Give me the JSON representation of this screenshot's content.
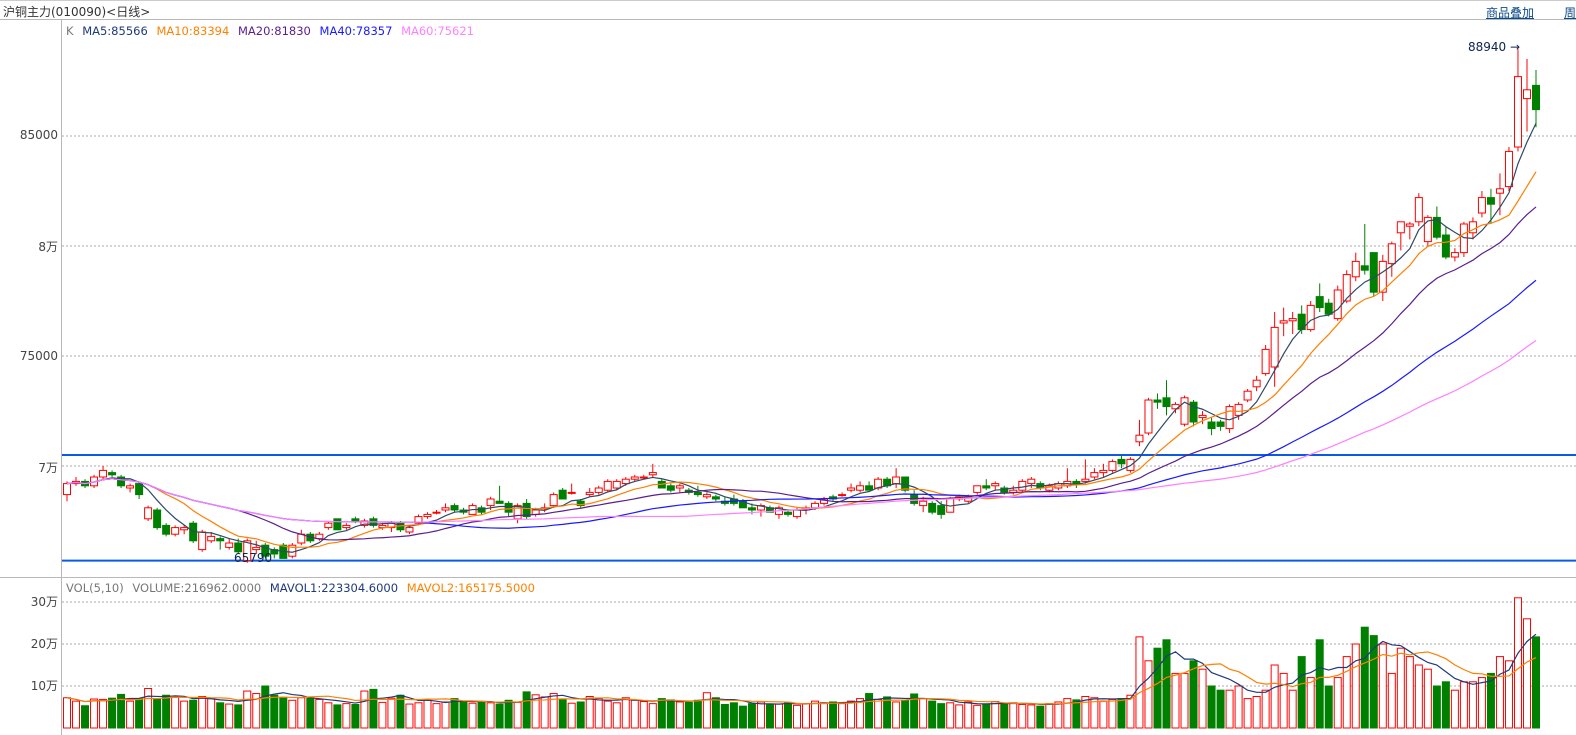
{
  "header": {
    "title": "沪铜主力(010090)<日线>",
    "overlay_link": "商品叠加",
    "period_link": "周"
  },
  "price_legend": {
    "k": "K",
    "ma5": "MA5:85566",
    "ma10": "MA10:83394",
    "ma20": "MA20:81830",
    "ma40": "MA40:78357",
    "ma60": "MA60:75621"
  },
  "volume_legend": {
    "vol": "VOL(5,10)",
    "volume": "VOLUME:216962.0000",
    "mavol1": "MAVOL1:223304.6000",
    "mavol2": "MAVOL2:165175.5000"
  },
  "colors": {
    "up": "#ff0000",
    "down": "#008000",
    "ma5": "#2f4a66",
    "ma10": "#ff8000",
    "ma20": "#5a1e8c",
    "ma40": "#1a1aff",
    "ma60": "#ff80ff",
    "support": "#0a5ae6"
  },
  "chart_data": {
    "type": "candlestick",
    "title": "沪铜主力(010090)<日线>",
    "y_ticks": [
      {
        "value": 85000,
        "label": "85000"
      },
      {
        "value": 80000,
        "label": "8万"
      },
      {
        "value": 75000,
        "label": "75000"
      },
      {
        "value": 70000,
        "label": "7万"
      }
    ],
    "vol_ticks": [
      {
        "value": 300000,
        "label": "30万"
      },
      {
        "value": 200000,
        "label": "20万"
      },
      {
        "value": 100000,
        "label": "10万"
      }
    ],
    "high_label": "88940",
    "low_label": "65790",
    "horizontal_lines": [
      70500,
      65700
    ],
    "ma_periods": [
      5,
      10,
      20,
      40,
      60
    ],
    "mavol_periods": [
      5,
      10
    ],
    "ohlc": [
      [
        68700,
        69300,
        68400,
        69200
      ],
      [
        69200,
        69500,
        69100,
        69300
      ],
      [
        69300,
        69400,
        69000,
        69100
      ],
      [
        69100,
        69600,
        69000,
        69500
      ],
      [
        69500,
        70000,
        69400,
        69800
      ],
      [
        69700,
        69800,
        69500,
        69600
      ],
      [
        69500,
        69600,
        69000,
        69100
      ],
      [
        69000,
        69200,
        68800,
        69100
      ],
      [
        69200,
        69300,
        68500,
        68700
      ],
      [
        67600,
        68200,
        67500,
        68100
      ],
      [
        68000,
        68100,
        67100,
        67200
      ],
      [
        67300,
        67400,
        66800,
        66900
      ],
      [
        66900,
        67300,
        66800,
        67200
      ],
      [
        67100,
        67300,
        66900,
        67200
      ],
      [
        67400,
        67500,
        66500,
        66600
      ],
      [
        66200,
        67100,
        66100,
        67000
      ],
      [
        66600,
        67000,
        66500,
        66800
      ],
      [
        66700,
        66800,
        66200,
        66600
      ],
      [
        66300,
        66700,
        66200,
        66500
      ],
      [
        66500,
        66700,
        66000,
        66100
      ],
      [
        65700,
        66700,
        65600,
        66600
      ],
      [
        66200,
        66600,
        66000,
        66300
      ],
      [
        66400,
        66500,
        65800,
        65900
      ],
      [
        66200,
        66300,
        65800,
        66000
      ],
      [
        66400,
        66500,
        65790,
        65800
      ],
      [
        65900,
        66500,
        65800,
        66400
      ],
      [
        66500,
        67100,
        66400,
        66900
      ],
      [
        66900,
        67000,
        66500,
        66600
      ],
      [
        66700,
        67000,
        66600,
        66900
      ],
      [
        67200,
        67500,
        67100,
        67400
      ],
      [
        67600,
        67600,
        67100,
        67100
      ],
      [
        67200,
        67400,
        67100,
        67300
      ],
      [
        67600,
        67700,
        67400,
        67500
      ],
      [
        67300,
        67600,
        67200,
        67500
      ],
      [
        67600,
        67700,
        67200,
        67300
      ],
      [
        67200,
        67400,
        67100,
        67300
      ],
      [
        67200,
        67500,
        67000,
        67400
      ],
      [
        67400,
        67500,
        67000,
        67100
      ],
      [
        67000,
        67300,
        66900,
        67200
      ],
      [
        67400,
        67800,
        67300,
        67700
      ],
      [
        67700,
        67900,
        67600,
        67800
      ],
      [
        67900,
        68000,
        67800,
        67900
      ],
      [
        68000,
        68300,
        67900,
        68100
      ],
      [
        68200,
        68300,
        67900,
        68000
      ],
      [
        68000,
        68100,
        67800,
        67900
      ],
      [
        67800,
        68300,
        67800,
        68200
      ],
      [
        68100,
        68200,
        67800,
        67900
      ],
      [
        68200,
        68600,
        68000,
        68500
      ],
      [
        68400,
        69100,
        68300,
        68300
      ],
      [
        68300,
        68400,
        67700,
        67900
      ],
      [
        67600,
        68300,
        67400,
        68200
      ],
      [
        68300,
        68500,
        67600,
        67700
      ],
      [
        67800,
        68100,
        67700,
        68000
      ],
      [
        68100,
        68300,
        67900,
        68100
      ],
      [
        68200,
        68800,
        68100,
        68700
      ],
      [
        68900,
        69000,
        68500,
        68500
      ],
      [
        68800,
        69200,
        68700,
        68800
      ],
      [
        68400,
        68500,
        68100,
        68200
      ],
      [
        68700,
        69000,
        68600,
        68800
      ],
      [
        68800,
        69100,
        68700,
        69000
      ],
      [
        68900,
        69400,
        68800,
        69300
      ],
      [
        69000,
        69400,
        68900,
        69300
      ],
      [
        69200,
        69500,
        69100,
        69400
      ],
      [
        69400,
        69600,
        69300,
        69500
      ],
      [
        69500,
        69600,
        69400,
        69500
      ],
      [
        69600,
        70100,
        69500,
        69700
      ],
      [
        69300,
        69400,
        69000,
        69000
      ],
      [
        69100,
        69200,
        68800,
        68900
      ],
      [
        69000,
        69200,
        68800,
        69100
      ],
      [
        68900,
        69000,
        68700,
        68800
      ],
      [
        68800,
        69100,
        68600,
        68700
      ],
      [
        68600,
        68800,
        68500,
        68700
      ],
      [
        68600,
        68700,
        68400,
        68500
      ],
      [
        68400,
        68600,
        68200,
        68300
      ],
      [
        68500,
        68700,
        68200,
        68300
      ],
      [
        68400,
        68500,
        68100,
        68100
      ],
      [
        68100,
        68300,
        67800,
        68000
      ],
      [
        68000,
        68300,
        67700,
        68200
      ],
      [
        68100,
        68200,
        67900,
        67900
      ],
      [
        67800,
        68200,
        67600,
        68100
      ],
      [
        67900,
        68000,
        67700,
        67800
      ],
      [
        67700,
        68100,
        67600,
        68000
      ],
      [
        68000,
        68200,
        67800,
        68100
      ],
      [
        68100,
        68400,
        68000,
        68300
      ],
      [
        68300,
        68600,
        68200,
        68500
      ],
      [
        68600,
        68700,
        68400,
        68500
      ],
      [
        68700,
        68800,
        68600,
        68700
      ],
      [
        68900,
        69200,
        68800,
        69000
      ],
      [
        68900,
        69300,
        68800,
        69100
      ],
      [
        69100,
        69300,
        68900,
        68900
      ],
      [
        69000,
        69500,
        68900,
        69400
      ],
      [
        69400,
        69500,
        69000,
        69100
      ],
      [
        69200,
        69900,
        69000,
        69500
      ],
      [
        69500,
        69500,
        68800,
        68900
      ],
      [
        68700,
        68900,
        68200,
        68300
      ],
      [
        68200,
        68600,
        67900,
        68400
      ],
      [
        68300,
        68400,
        67800,
        67900
      ],
      [
        68200,
        68400,
        67600,
        67800
      ],
      [
        67900,
        68600,
        67900,
        68500
      ],
      [
        68500,
        68700,
        68400,
        68600
      ],
      [
        68400,
        68700,
        68300,
        68600
      ],
      [
        68800,
        69100,
        68700,
        69100
      ],
      [
        69100,
        69400,
        68900,
        69000
      ],
      [
        69100,
        69300,
        68900,
        69200
      ],
      [
        69000,
        69100,
        68700,
        68800
      ],
      [
        68800,
        69100,
        68700,
        68900
      ],
      [
        68900,
        69400,
        68800,
        69300
      ],
      [
        69200,
        69500,
        69000,
        69400
      ],
      [
        69200,
        69300,
        68900,
        69000
      ],
      [
        68900,
        69200,
        68800,
        69100
      ],
      [
        69000,
        69300,
        68900,
        69200
      ],
      [
        69100,
        69900,
        69000,
        69300
      ],
      [
        69300,
        69400,
        69000,
        69200
      ],
      [
        69300,
        70300,
        69200,
        69400
      ],
      [
        69500,
        69900,
        69400,
        69700
      ],
      [
        69700,
        70100,
        69500,
        69800
      ],
      [
        69800,
        70300,
        69700,
        70200
      ],
      [
        70300,
        70500,
        69900,
        70100
      ],
      [
        69800,
        70400,
        69700,
        70300
      ],
      [
        71100,
        72100,
        70900,
        71400
      ],
      [
        71500,
        73100,
        71400,
        73000
      ],
      [
        73000,
        73300,
        72600,
        72900
      ],
      [
        73100,
        73900,
        72300,
        72700
      ],
      [
        72600,
        72900,
        72400,
        72800
      ],
      [
        71900,
        73200,
        71800,
        73100
      ],
      [
        72900,
        73000,
        71800,
        72000
      ],
      [
        72200,
        72500,
        71900,
        72300
      ],
      [
        72000,
        72200,
        71400,
        71700
      ],
      [
        72000,
        72100,
        71600,
        71800
      ],
      [
        71700,
        72800,
        71500,
        72700
      ],
      [
        72300,
        72900,
        72100,
        72800
      ],
      [
        73000,
        73500,
        72900,
        73400
      ],
      [
        73600,
        74100,
        73400,
        73900
      ],
      [
        74200,
        75500,
        74100,
        75300
      ],
      [
        74500,
        77000,
        73600,
        76300
      ],
      [
        76500,
        77200,
        75900,
        76600
      ],
      [
        76600,
        77000,
        76000,
        76700
      ],
      [
        76900,
        77300,
        76000,
        76200
      ],
      [
        76200,
        77500,
        76100,
        77300
      ],
      [
        77700,
        78300,
        77000,
        77200
      ],
      [
        77400,
        77600,
        76800,
        76900
      ],
      [
        76700,
        78200,
        76600,
        78000
      ],
      [
        77500,
        78900,
        77400,
        78700
      ],
      [
        78600,
        79700,
        78400,
        79300
      ],
      [
        79100,
        81000,
        78700,
        78900
      ],
      [
        79700,
        79700,
        77700,
        77900
      ],
      [
        77900,
        79600,
        77500,
        79300
      ],
      [
        79200,
        80200,
        78600,
        80100
      ],
      [
        80600,
        81100,
        79800,
        81100
      ],
      [
        80900,
        81100,
        80300,
        81000
      ],
      [
        81100,
        82400,
        80900,
        82200
      ],
      [
        80200,
        81400,
        80000,
        81300
      ],
      [
        81300,
        81800,
        80300,
        80400
      ],
      [
        80500,
        80900,
        79400,
        79500
      ],
      [
        79500,
        79900,
        79300,
        79700
      ],
      [
        79700,
        81100,
        79500,
        81000
      ],
      [
        80600,
        81300,
        80300,
        81100
      ],
      [
        81500,
        82500,
        81300,
        82200
      ],
      [
        82200,
        82600,
        81000,
        81900
      ],
      [
        82400,
        83300,
        81400,
        82600
      ],
      [
        82700,
        84500,
        82500,
        84300
      ],
      [
        84500,
        88940,
        84300,
        87700
      ],
      [
        86700,
        88500,
        85200,
        87100
      ],
      [
        87300,
        88000,
        85400,
        86200
      ]
    ],
    "volume": [
      72000,
      64000,
      53000,
      69000,
      68000,
      71000,
      80000,
      64000,
      70000,
      94000,
      68000,
      78000,
      73000,
      64000,
      66000,
      75000,
      70000,
      60000,
      57000,
      55000,
      88000,
      82000,
      100000,
      78000,
      72000,
      66000,
      72000,
      71000,
      68000,
      60000,
      55000,
      58000,
      56000,
      88000,
      92000,
      61000,
      71000,
      78000,
      57000,
      60000,
      66000,
      58000,
      62000,
      70000,
      64000,
      59000,
      62000,
      60000,
      57000,
      66000,
      61000,
      86000,
      79000,
      74000,
      82000,
      68000,
      59000,
      62000,
      75000,
      70000,
      64000,
      60000,
      72000,
      66000,
      63000,
      58000,
      70000,
      67000,
      62000,
      61000,
      66000,
      84000,
      72000,
      56000,
      60000,
      52000,
      58000,
      62000,
      55000,
      57000,
      61000,
      54000,
      58000,
      64000,
      60000,
      62000,
      58000,
      64000,
      70000,
      82000,
      68000,
      74000,
      62000,
      66000,
      81000,
      70000,
      64000,
      58000,
      60000,
      55000,
      62000,
      54000,
      56000,
      63000,
      58000,
      60000,
      56000,
      55000,
      52000,
      58000,
      62000,
      70000,
      67000,
      75000,
      72000,
      64000,
      68000,
      70000,
      78000,
      217000,
      160000,
      190000,
      210000,
      130000,
      130000,
      160000,
      140000,
      100000,
      90000,
      90000,
      100000,
      70000,
      75000,
      90000,
      150000,
      130000,
      90000,
      170000,
      120000,
      210000,
      100000,
      120000,
      170000,
      200000,
      240000,
      220000,
      200000,
      130000,
      190000,
      170000,
      150000,
      140000,
      100000,
      110000,
      90000,
      110000,
      110000,
      120000,
      130000,
      170000,
      160000,
      310000,
      260000,
      216962
    ]
  }
}
